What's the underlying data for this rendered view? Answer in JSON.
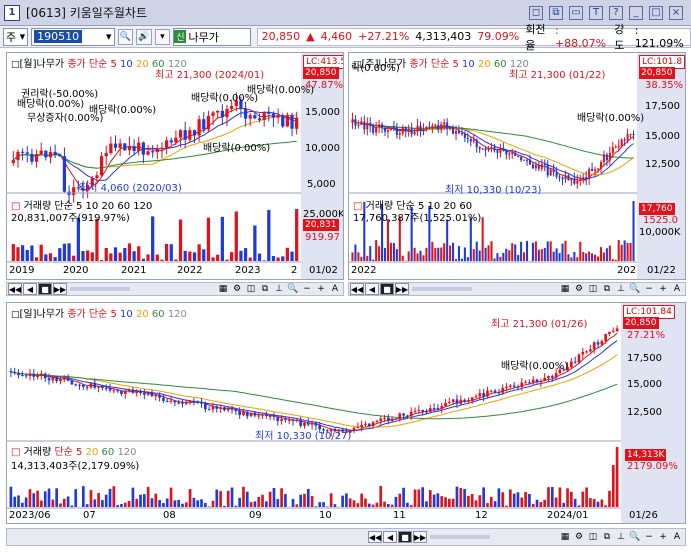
{
  "window": {
    "number": "1",
    "title": "[0613] 키움일주월차트",
    "buttons": [
      "◻",
      "⧉",
      "▭",
      "T",
      "?",
      "_",
      "□",
      "×"
    ]
  },
  "toolbar": {
    "market": "주",
    "code": "190510",
    "name_badge": "신",
    "name": "나무가",
    "price": "20,850",
    "change_arrow": "▲",
    "change": "4,460",
    "change_pct": "+27.21%",
    "volume": "4,313,403",
    "vol_ratio": "79.09%",
    "turnover_label": "회전율",
    "turnover": ": +88.07%",
    "strength_label": "강도",
    "strength": ": 121.09%"
  },
  "monthly": {
    "header": "[월]나무가",
    "ma_label": "종가 단순",
    "ma_values": [
      "5",
      "10",
      "20",
      "60",
      "120"
    ],
    "high_label": "최고 21,300 (2024/01)",
    "low_label": "최저 4,060 (2020/03)",
    "annotations": [
      "권리락(-50.00%)",
      "배당락(0.00%)",
      "무상증자(0.00%)",
      "배당락(0.00%)",
      "배당락(0.00%)",
      "배당락(0.00%)",
      "배당락(0.00%)"
    ],
    "price_axis": [
      "15,000",
      "10,000",
      "5,000"
    ],
    "tag_lc": "LC:413.5",
    "tag_price": "20,850",
    "tag_pct": "47.87%",
    "vol_header": "거래량 단순 5 10 20 60 120",
    "vol_value": "20,831,007주(919.97%)",
    "vol_axis": "25,000K",
    "vol_tag": "20,831",
    "vol_pct": "919.97",
    "x_axis": [
      "2019",
      "2020",
      "2021",
      "2022",
      "2023",
      "2"
    ],
    "date": "01/02"
  },
  "weekly": {
    "header": "[주]나무가",
    "ma_label": "종가 단순",
    "ma_values": [
      "5",
      "10",
      "20",
      "60",
      "120"
    ],
    "high_label": "최고 21,300 (01/22)",
    "low_label": "최저 10,330 (10/23)",
    "annotations": [
      "락(0.00%)",
      "배당락(0.00%)"
    ],
    "price_axis": [
      "17,500",
      "15,000",
      "12,500"
    ],
    "tag_lc": "LC:101.8",
    "tag_price": "20,850",
    "tag_pct": "38.35%",
    "vol_header": "거래량 단순 5 10 20 60",
    "vol_value": "17,760,387주(1,525.01%)",
    "vol_axis": "10,000K",
    "vol_tag": "17,760",
    "vol_pct": "1525.0",
    "x_axis": [
      "2022",
      "202"
    ],
    "date": "01/22"
  },
  "daily": {
    "header": "[일]나무가",
    "ma_label": "종가 단순",
    "ma_values": [
      "5",
      "10",
      "20",
      "60",
      "120"
    ],
    "high_label": "최고 21,300 (01/26)",
    "low_label": "최저 10,330 (10/27)",
    "annotation": "배당락(0.00%)",
    "price_axis": [
      "17,500",
      "15,000",
      "12,500"
    ],
    "tag_lc": "LC:101.84",
    "tag_price": "20,850",
    "tag_pct": "27.21%",
    "vol_header_label": "거래량",
    "vol_ma_label": "단순",
    "vol_ma_values": [
      "5",
      "20",
      "60",
      "120"
    ],
    "vol_value": "14,313,403주(2,179.09%)",
    "vol_tag": "14,313K",
    "vol_pct": "2179.09%",
    "x_axis": [
      "2023/06",
      "07",
      "08",
      "09",
      "10",
      "11",
      "12",
      "2024/01"
    ],
    "date": "01/26"
  },
  "colors": {
    "up": "#e0121b",
    "down": "#1f3ad8",
    "ma5": "#e0121b",
    "ma10": "#1f3ad8",
    "ma20": "#f0a000",
    "ma60": "#2e8b3a",
    "ma120": "#888888",
    "panel_bg": "#dfe3f2"
  }
}
